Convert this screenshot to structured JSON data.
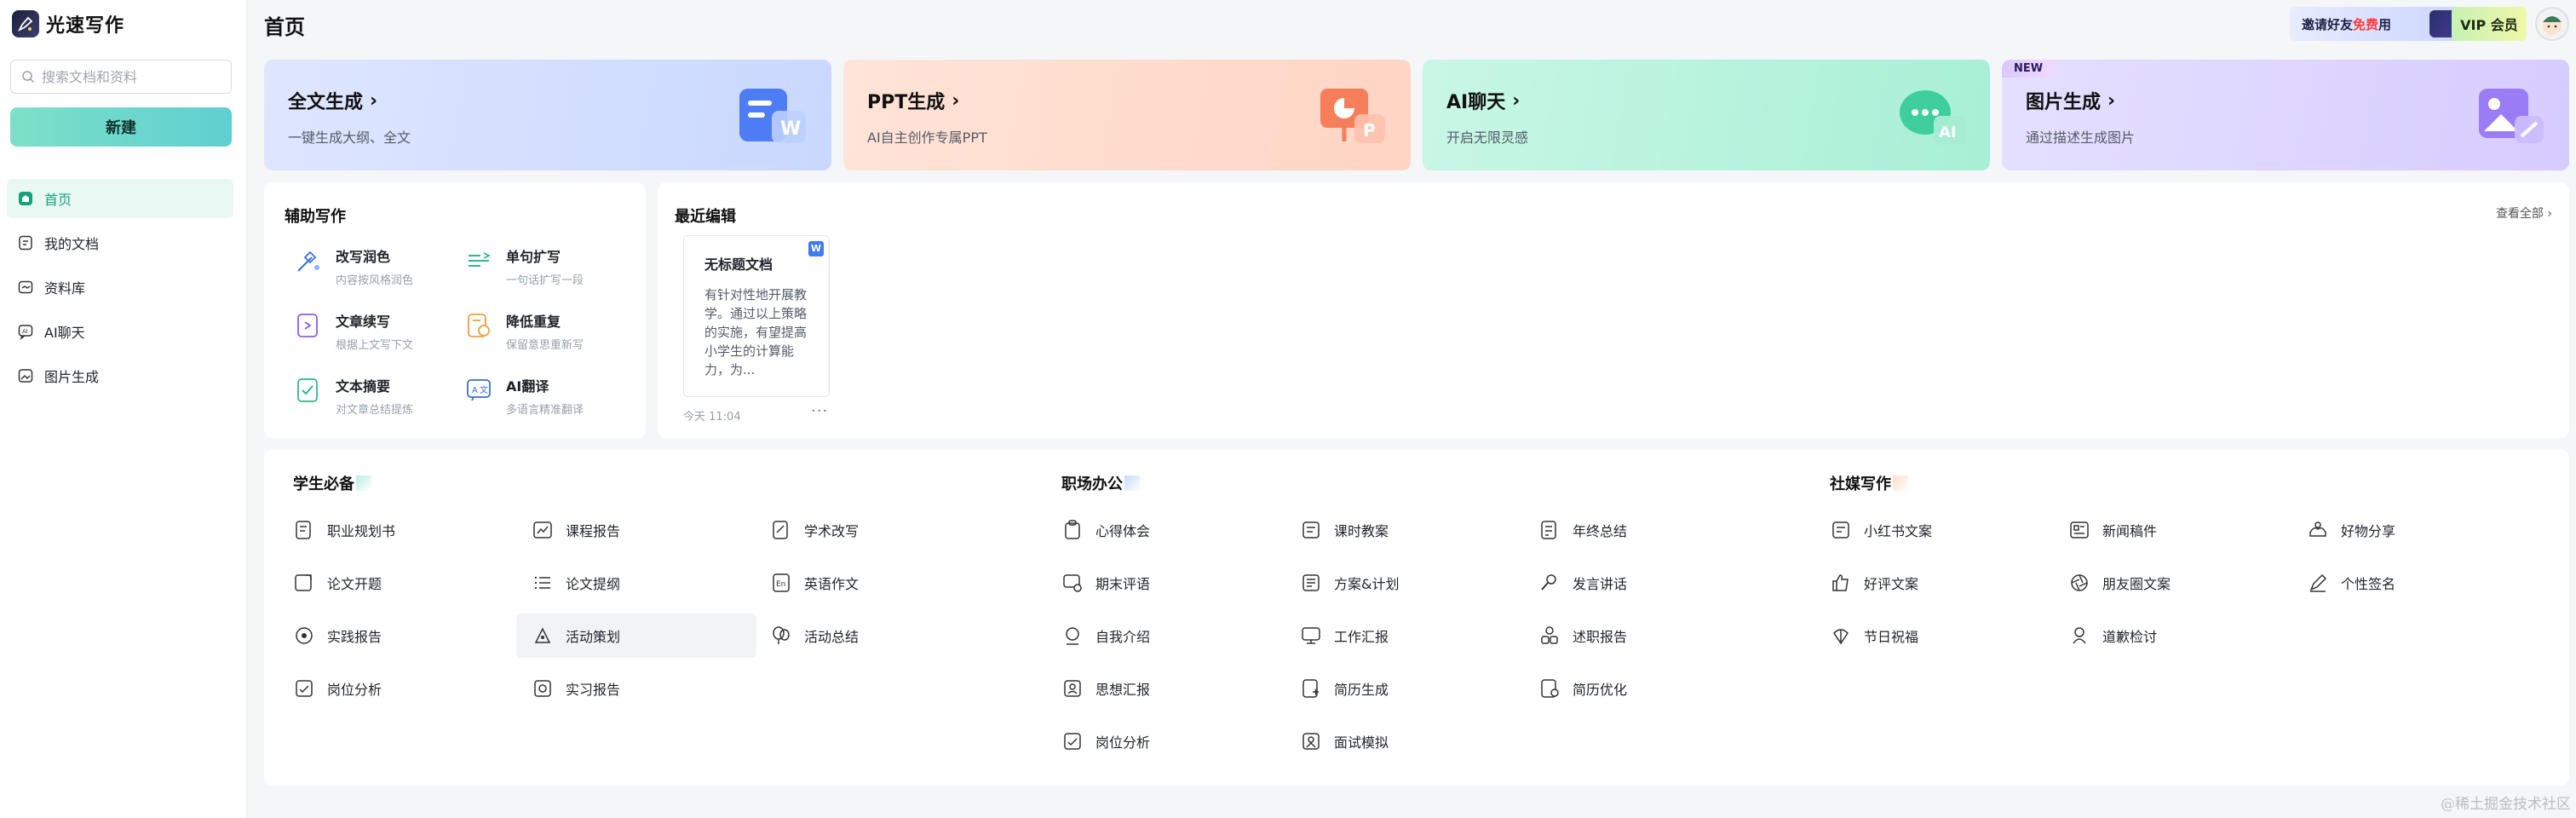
{
  "app": {
    "name": "光速写作"
  },
  "sidebar": {
    "search_placeholder": "搜索文档和资料",
    "new_button": "新建",
    "items": [
      {
        "label": "首页",
        "icon": "home-icon",
        "active": true
      },
      {
        "label": "我的文档",
        "icon": "document-icon",
        "active": false
      },
      {
        "label": "资料库",
        "icon": "folder-icon",
        "active": false
      },
      {
        "label": "AI聊天",
        "icon": "chat-icon",
        "active": false
      },
      {
        "label": "图片生成",
        "icon": "image-icon",
        "active": false
      }
    ]
  },
  "header": {
    "title": "首页",
    "invite_prefix": "邀请好友",
    "invite_highlight": "免费",
    "invite_suffix": "用",
    "vip_label": "VIP 会员"
  },
  "features": [
    {
      "title": "全文生成",
      "sub": "一键生成大纲、全文",
      "icon": "word-doc-icon"
    },
    {
      "title": "PPT生成",
      "sub": "AI自主创作专属PPT",
      "icon": "ppt-icon"
    },
    {
      "title": "AI聊天",
      "sub": "开启无限灵感",
      "icon": "ai-chat-icon"
    },
    {
      "title": "图片生成",
      "sub": "通过描述生成图片",
      "icon": "image-gen-icon",
      "tag": "NEW"
    }
  ],
  "assist": {
    "title": "辅助写作",
    "tools": [
      {
        "name": "改写润色",
        "desc": "内容按风格润色",
        "icon": "magic-wand-icon"
      },
      {
        "name": "单句扩写",
        "desc": "一句话扩写一段",
        "icon": "expand-icon"
      },
      {
        "name": "文章续写",
        "desc": "根据上文写下文",
        "icon": "continue-icon"
      },
      {
        "name": "降低重复",
        "desc": "保留意思重新写",
        "icon": "dedupe-icon"
      },
      {
        "name": "文本摘要",
        "desc": "对文章总结提炼",
        "icon": "summary-icon"
      },
      {
        "name": "AI翻译",
        "desc": "多语言精准翻译",
        "icon": "translate-icon"
      }
    ]
  },
  "recent": {
    "title": "最近编辑",
    "view_all": "查看全部",
    "doc": {
      "badge": "W",
      "title": "无标题文档",
      "body": "有针对性地开展教学。通过以上策略的实施，有望提高小学生的计算能力，为...",
      "time": "今天 11:04",
      "more": "···"
    }
  },
  "categories": [
    {
      "title": "学生必备",
      "items": [
        "职业规划书",
        "课程报告",
        "学术改写",
        "论文开题",
        "论文提纲",
        "英语作文",
        "实践报告",
        "活动策划",
        "活动总结",
        "岗位分析",
        "实习报告"
      ]
    },
    {
      "title": "职场办公",
      "items": [
        "心得体会",
        "课时教案",
        "年终总结",
        "期末评语",
        "方案&计划",
        "发言讲话",
        "自我介绍",
        "工作汇报",
        "述职报告",
        "思想汇报",
        "简历生成",
        "简历优化",
        "岗位分析",
        "面试模拟"
      ]
    },
    {
      "title": "社媒写作",
      "items": [
        "小红书文案",
        "新闻稿件",
        "好物分享",
        "好评文案",
        "朋友圈文案",
        "个性签名",
        "节日祝福",
        "道歉检讨"
      ]
    }
  ],
  "colors": {
    "accent": "#18a27a",
    "new_button": "#6fd8cc"
  },
  "watermark": "@稀土掘金技术社区"
}
